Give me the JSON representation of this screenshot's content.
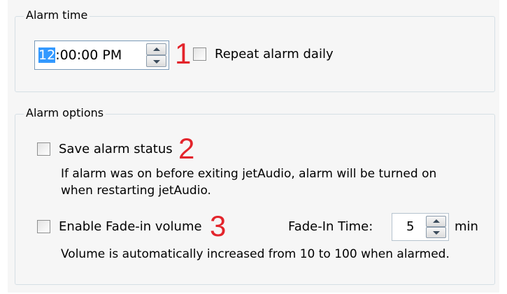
{
  "alarm_time": {
    "group_label": "Alarm time",
    "time_hours": "12",
    "time_rest": ":00:00 PM",
    "repeat_label": "Repeat alarm daily",
    "repeat_checked": false
  },
  "alarm_options": {
    "group_label": "Alarm options",
    "save_status_label": "Save alarm status",
    "save_status_checked": false,
    "save_status_desc_line1": "If alarm was on before exiting jetAudio, alarm will be turned on",
    "save_status_desc_line2": "when restarting jetAudio.",
    "fade_label": "Enable Fade-in volume",
    "fade_checked": false,
    "fade_time_label": "Fade-In Time:",
    "fade_time_value": "5",
    "fade_time_unit": "min",
    "fade_desc": "Volume is automatically increased from 10 to 100 when alarmed."
  },
  "markers": [
    "1",
    "2",
    "3"
  ],
  "colors": {
    "marker": "#e3242b",
    "selection": "#3399ff",
    "panel_bg": "#f6f6f6",
    "group_border": "#d5dfe5"
  }
}
